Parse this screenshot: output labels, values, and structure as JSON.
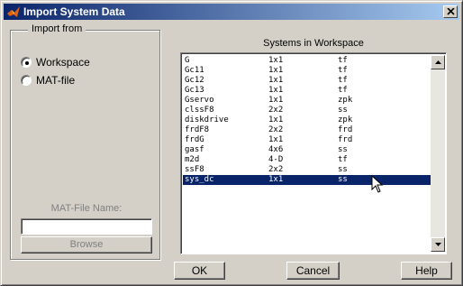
{
  "window": {
    "title": "Import System Data",
    "close_icon": "close-icon",
    "app_icon": "matlab-icon"
  },
  "import_from": {
    "title": "Import from",
    "options": [
      {
        "label": "Workspace",
        "selected": true
      },
      {
        "label": "MAT-file",
        "selected": false
      }
    ],
    "matfile_label": "MAT-File Name:",
    "matfile_value": "",
    "browse_label": "Browse"
  },
  "workspace": {
    "title": "Systems in Workspace",
    "rows": [
      [
        "G",
        "1x1",
        "tf"
      ],
      [
        "Gc11",
        "1x1",
        "tf"
      ],
      [
        "Gc12",
        "1x1",
        "tf"
      ],
      [
        "Gc13",
        "1x1",
        "tf"
      ],
      [
        "Gservo",
        "1x1",
        "zpk"
      ],
      [
        "clssF8",
        "2x2",
        "ss"
      ],
      [
        "diskdrive",
        "1x1",
        "zpk"
      ],
      [
        "frdF8",
        "2x2",
        "frd"
      ],
      [
        "frdG",
        "1x1",
        "frd"
      ],
      [
        "gasf",
        "4x6",
        "ss"
      ],
      [
        "m2d",
        "4-D",
        "tf"
      ],
      [
        "ssF8",
        "2x2",
        "ss"
      ],
      [
        "sys_dc",
        "1x1",
        "ss"
      ]
    ],
    "selected_index": 12
  },
  "buttons": {
    "ok": "OK",
    "cancel": "Cancel",
    "help": "Help"
  }
}
